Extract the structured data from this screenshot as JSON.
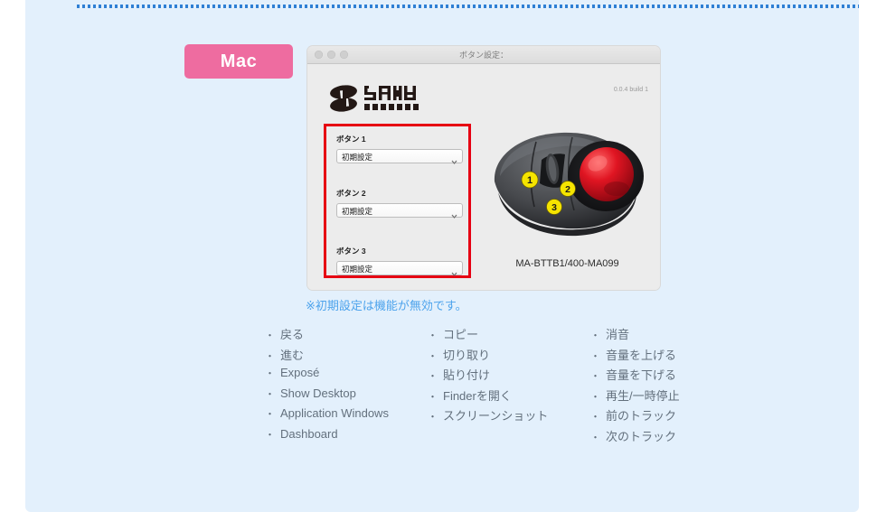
{
  "badge": {
    "label": "Mac"
  },
  "window": {
    "title": "ボタン設定：",
    "version": "0.0.4 build 1",
    "logo": {
      "brand": "SANWA",
      "sub": "SUPPLY",
      "icon": "sanwa-logo-icon"
    },
    "traffic_lights": [
      "close",
      "minimize",
      "zoom"
    ],
    "fields": [
      {
        "label": "ボタン 1",
        "value": "初期設定"
      },
      {
        "label": "ボタン 2",
        "value": "初期設定"
      },
      {
        "label": "ボタン 3",
        "value": "初期設定"
      }
    ],
    "device": {
      "model": "MA-BTTB1/400-MA099",
      "callouts": [
        "1",
        "2",
        "3"
      ]
    }
  },
  "note": "※初期設定は機能が無効です。",
  "features": {
    "bullet": "・",
    "columns": [
      {
        "items": [
          "戻る",
          "進む",
          "Exposé",
          "Show Desktop",
          "Application Windows",
          "Dashboard"
        ]
      },
      {
        "items": [
          "コピー",
          "切り取り",
          "貼り付け",
          "Finderを開く",
          "スクリーンショット"
        ]
      },
      {
        "items": [
          "消音",
          "音量を上げる",
          "音量を下げる",
          "再生/一時停止",
          "前のトラック",
          "次のトラック"
        ]
      }
    ]
  },
  "colors": {
    "panel_bg": "#e3f0fc",
    "badge_pink": "#ee6ca0",
    "accent_red": "#e60012",
    "note_blue": "#4da3ec",
    "rule_blue": "#2e7fd4",
    "text_gray": "#63707d",
    "ball_red": "#d81122"
  }
}
